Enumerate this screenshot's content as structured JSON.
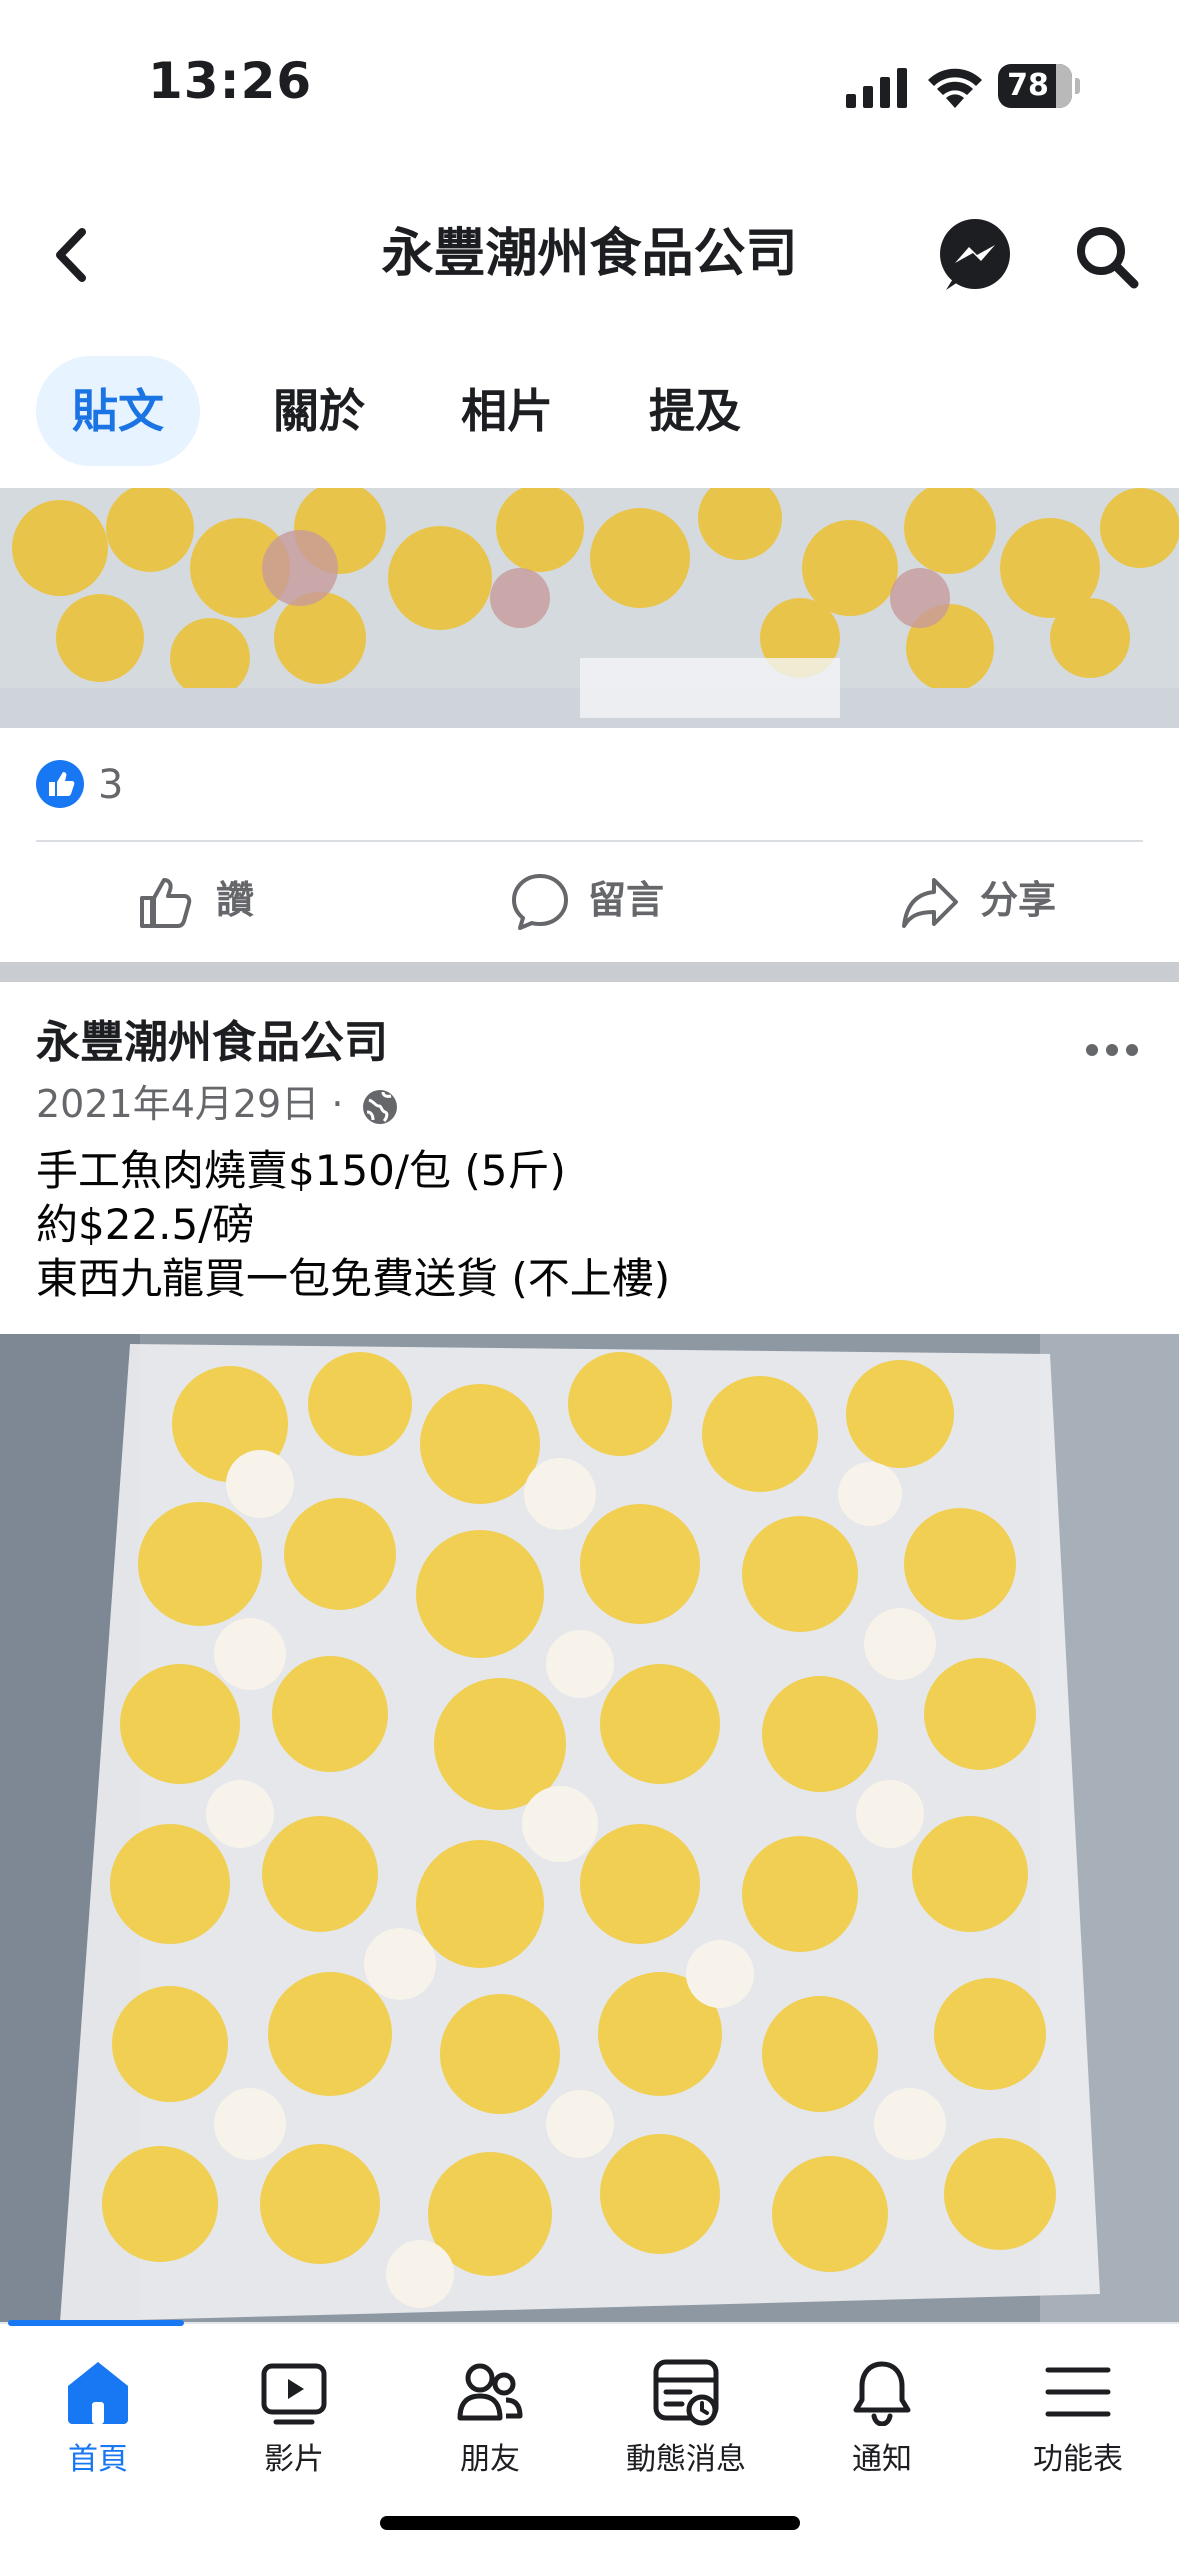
{
  "status_bar": {
    "time": "13:26",
    "battery": "78"
  },
  "header": {
    "title": "永豐潮州食品公司"
  },
  "tabs": [
    {
      "label": "貼文",
      "active": true
    },
    {
      "label": "關於",
      "active": false
    },
    {
      "label": "相片",
      "active": false
    },
    {
      "label": "提及",
      "active": false
    }
  ],
  "prev_post": {
    "reaction_count": "3",
    "actions": {
      "like": "讚",
      "comment": "留言",
      "share": "分享"
    }
  },
  "post": {
    "author": "永豐潮州食品公司",
    "date": "2021年4月29日 · ",
    "lines": [
      "手工魚肉燒賣$150/包 (5斤)",
      "約$22.5/磅",
      "東西九龍買一包免費送貨 (不上樓)"
    ]
  },
  "tabbar": [
    {
      "label": "首頁",
      "icon": "home-icon",
      "active": true
    },
    {
      "label": "影片",
      "icon": "video-icon",
      "active": false
    },
    {
      "label": "朋友",
      "icon": "friends-icon",
      "active": false
    },
    {
      "label": "動態消息",
      "icon": "feed-icon",
      "active": false
    },
    {
      "label": "通知",
      "icon": "bell-icon",
      "active": false
    },
    {
      "label": "功能表",
      "icon": "menu-icon",
      "active": false
    }
  ],
  "colors": {
    "accent": "#1877f2",
    "active_tab_bg": "#e7f3ff",
    "muted_text": "#65676b"
  }
}
